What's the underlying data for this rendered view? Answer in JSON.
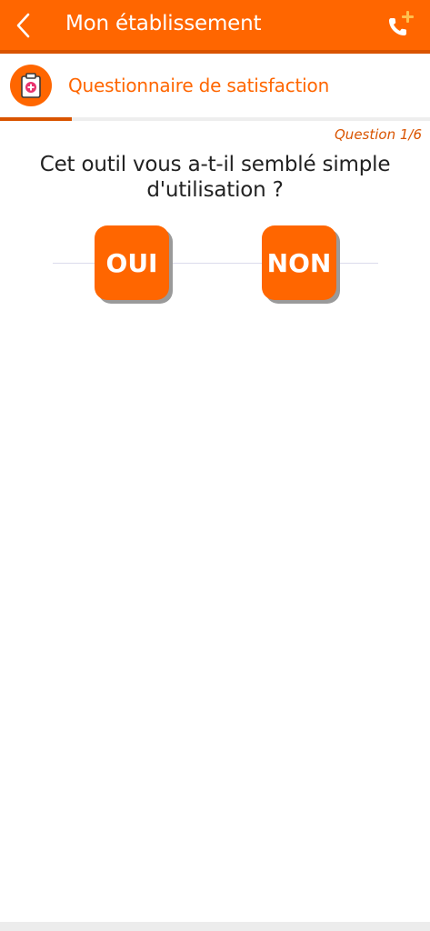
{
  "header": {
    "back_icon": "chevron-left-icon",
    "title": "Mon établissement",
    "call_icon": "phone-add-icon",
    "accent_color": "#ff6600"
  },
  "subheader": {
    "icon": "medical-clipboard-icon",
    "title": "Questionnaire de satisfaction"
  },
  "progress": {
    "fraction": 0.1667
  },
  "question": {
    "counter": "Question 1/6",
    "text": "Cet outil vous a-t-il semblé simple d'utilisation ?"
  },
  "answers": {
    "yes_label": "OUI",
    "no_label": "NON"
  }
}
